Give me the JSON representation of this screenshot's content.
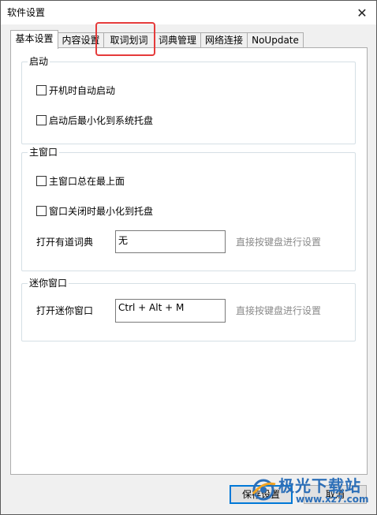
{
  "window": {
    "title": "软件设置",
    "close_symbol": "✕"
  },
  "tabs": [
    {
      "label": "基本设置",
      "active": true
    },
    {
      "label": "内容设置"
    },
    {
      "label": "取词划词"
    },
    {
      "label": "词典管理"
    },
    {
      "label": "网络连接"
    },
    {
      "label": "NoUpdate"
    }
  ],
  "startup_group": {
    "title": "启动",
    "options": [
      "开机时自动启动",
      "启动后最小化到系统托盘"
    ]
  },
  "main_window_group": {
    "title": "主窗口",
    "options": [
      "主窗口总在最上面",
      "窗口关闭时最小化到托盘"
    ],
    "hotkey_label": "打开有道词典",
    "hotkey_value": "无",
    "hotkey_hint": "直接按键盘进行设置"
  },
  "mini_window_group": {
    "title": "迷你窗口",
    "hotkey_label": "打开迷你窗口",
    "hotkey_value": "Ctrl + Alt + M",
    "hotkey_hint": "直接按键盘进行设置"
  },
  "buttons": {
    "save": "保存设置",
    "cancel": "取消"
  },
  "watermark": {
    "brand": "极光下载站",
    "url": "www.xz7.com"
  },
  "colors": {
    "highlight": "#e53b3b",
    "default_button_border": "#0078d7",
    "watermark": "#2c6fb8"
  }
}
